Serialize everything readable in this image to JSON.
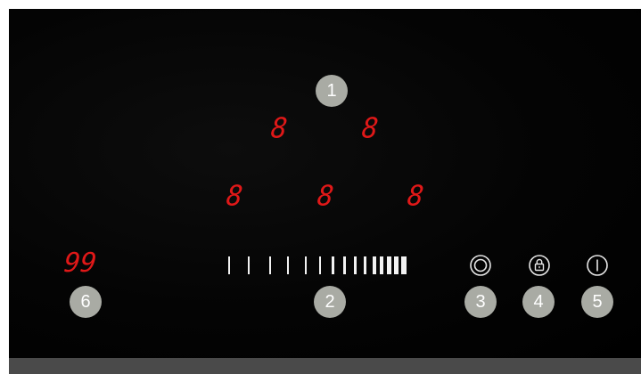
{
  "zone_displays": [
    {
      "id": "rear-left",
      "value": "8"
    },
    {
      "id": "rear-right",
      "value": "8"
    },
    {
      "id": "front-left",
      "value": "8"
    },
    {
      "id": "front-middle",
      "value": "8"
    },
    {
      "id": "front-right",
      "value": "8"
    }
  ],
  "timer_display": "99",
  "callouts": {
    "c1": "1",
    "c2": "2",
    "c3": "3",
    "c4": "4",
    "c5": "5",
    "c6": "6"
  },
  "slider": {
    "tick_count": 15
  },
  "icons": {
    "zone_select": "concentric-circles-icon",
    "lock": "padlock-icon",
    "power": "power-icon"
  },
  "colors": {
    "display_red": "#e01818",
    "panel_black": "#000000",
    "badge_gray": "#a9aba4",
    "bottom_strip": "#4a4a4a"
  }
}
